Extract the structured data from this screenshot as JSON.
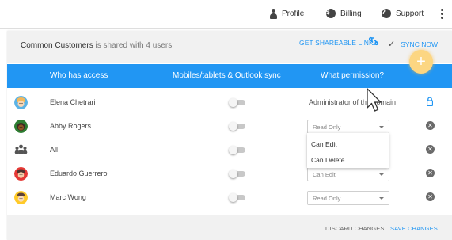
{
  "topnav": {
    "items": [
      {
        "label": "Profile",
        "icon": "person-icon"
      },
      {
        "label": "Billing",
        "icon": "dollar-icon",
        "glyph": "$"
      },
      {
        "label": "Support",
        "icon": "question-icon",
        "glyph": "?"
      }
    ]
  },
  "panel": {
    "list_name": "Common Customers",
    "shared_text": " is shared with 4 users",
    "share_link_label": "GET SHAREABLE LINK",
    "sync_now_label": "SYNC NOW",
    "fab_glyph": "+"
  },
  "table": {
    "headers": {
      "who": "Who has access",
      "sync": "Mobiles/tablets & Outlook sync",
      "permission": "What permission?"
    },
    "rows": [
      {
        "name": "Elena Chetrari",
        "permission": "Administrator of the domain",
        "control": "lock"
      },
      {
        "name": "Abby Rogers",
        "permission": "Read Only",
        "control": "remove"
      },
      {
        "name": "All",
        "permission": "",
        "control": "remove"
      },
      {
        "name": "Eduardo Guerrero",
        "permission": "Can Edit",
        "control": "remove"
      },
      {
        "name": "Marc Wong",
        "permission": "Read Only",
        "control": "remove"
      }
    ],
    "dropdown_options": [
      "Can Edit",
      "Can Delete"
    ]
  },
  "footer": {
    "discard_label": "DISCARD CHANGES",
    "save_label": "SAVE CHANGES"
  },
  "colors": {
    "accent": "#2196f3",
    "fab": "#fcd682"
  }
}
